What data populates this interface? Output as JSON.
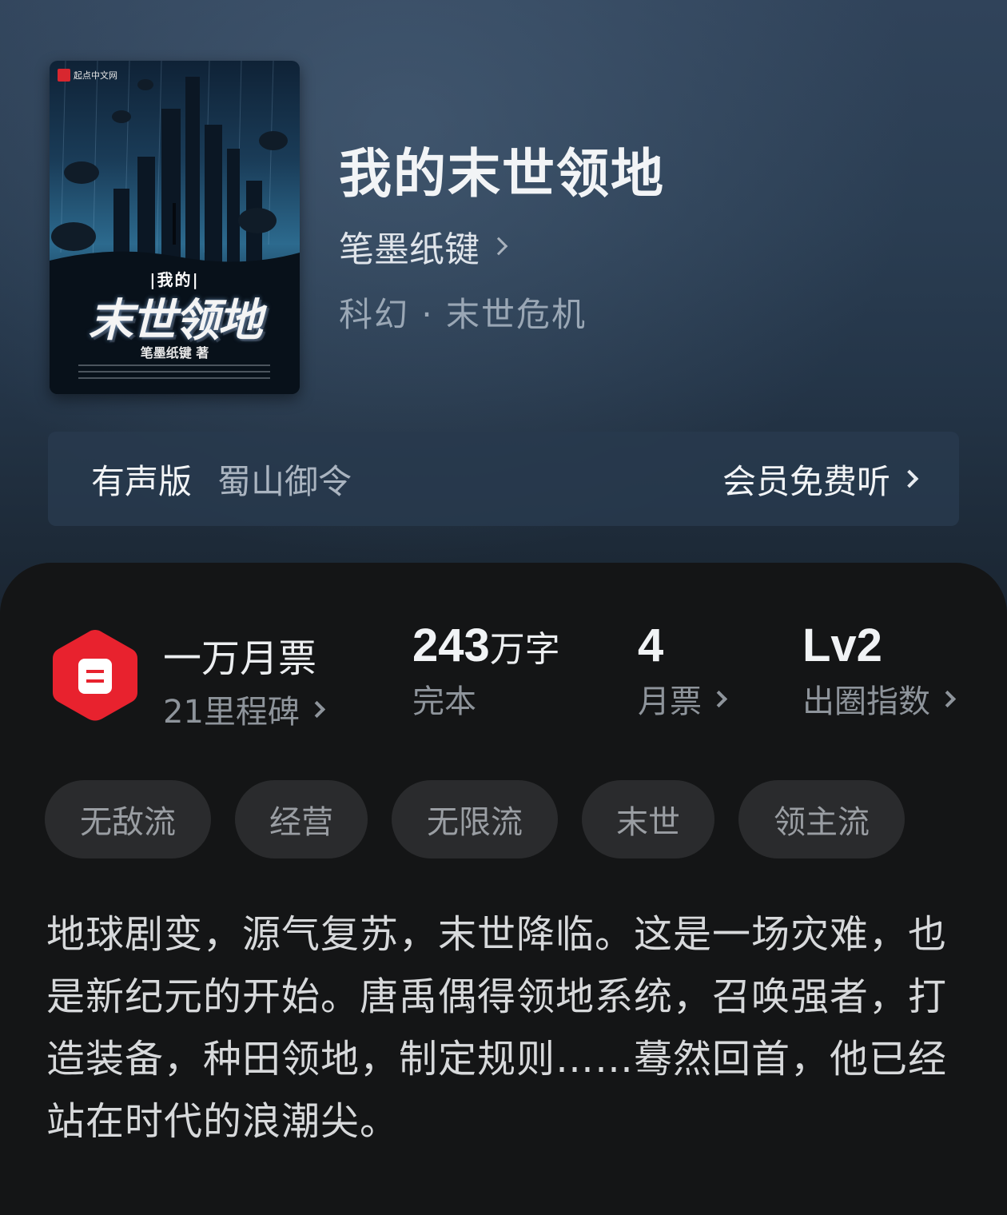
{
  "cover": {
    "publisher": "起点中文网",
    "subtitle": "|我的|",
    "title": "末世领地",
    "author": "笔墨纸键",
    "author_suffix": "著"
  },
  "book": {
    "title": "我的末世领地",
    "author": "笔墨纸键",
    "category": "科幻 · 末世危机"
  },
  "audio": {
    "label": "有声版",
    "narrator": "蜀山御令",
    "action": "会员免费听"
  },
  "stats": {
    "ticket_title": "一万月票",
    "ticket_sub": "21里程碑",
    "word_count": "243",
    "word_unit": "万字",
    "status": "完本",
    "monthly_tickets": "4",
    "monthly_label": "月票",
    "level": "Lv2",
    "level_label": "出圈指数"
  },
  "tags": [
    "无敌流",
    "经营",
    "无限流",
    "末世",
    "领主流"
  ],
  "description": "地球剧变，源气复苏，末世降临。这是一场灾难，也是新纪元的开始。唐禹偶得领地系统，召唤强者，打造装备，种田领地，制定规则……蓦然回首，他已经站在时代的浪潮尖。",
  "colors": {
    "badge_red": "#e8222e",
    "panel_bg": "#141516",
    "tag_bg": "#2a2b2d"
  }
}
